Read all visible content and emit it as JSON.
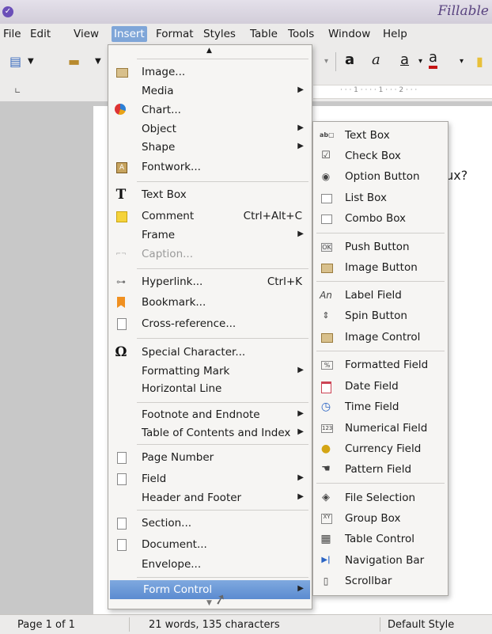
{
  "window": {
    "title": "Fillable"
  },
  "menubar": {
    "items": [
      "File",
      "Edit",
      "View",
      "Insert",
      "Format",
      "Styles",
      "Table",
      "Tools",
      "Window",
      "Help"
    ]
  },
  "document": {
    "visible_text": "nux?"
  },
  "insert_menu": {
    "items": [
      {
        "label": "Image...",
        "icon": "image-icon"
      },
      {
        "label": "Media",
        "submenu": true
      },
      {
        "label": "Chart...",
        "icon": "chart-icon"
      },
      {
        "label": "Object",
        "submenu": true
      },
      {
        "label": "Shape",
        "submenu": true
      },
      {
        "label": "Fontwork...",
        "icon": "fontwork-icon"
      },
      {
        "label": "Text Box",
        "icon": "text-box-icon"
      },
      {
        "label": "Comment",
        "shortcut": "Ctrl+Alt+C",
        "icon": "comment-icon"
      },
      {
        "label": "Frame",
        "submenu": true
      },
      {
        "label": "Caption...",
        "disabled": true,
        "icon": "caption-icon"
      },
      {
        "label": "Hyperlink...",
        "shortcut": "Ctrl+K",
        "icon": "hyperlink-icon"
      },
      {
        "label": "Bookmark...",
        "icon": "bookmark-icon"
      },
      {
        "label": "Cross-reference...",
        "icon": "cross-reference-icon"
      },
      {
        "label": "Special Character...",
        "icon": "omega-icon"
      },
      {
        "label": "Formatting Mark",
        "submenu": true
      },
      {
        "label": "Horizontal Line"
      },
      {
        "label": "Footnote and Endnote",
        "submenu": true
      },
      {
        "label": "Table of Contents and Index",
        "submenu": true
      },
      {
        "label": "Page Number",
        "icon": "page-number-icon"
      },
      {
        "label": "Field",
        "submenu": true,
        "icon": "field-icon"
      },
      {
        "label": "Header and Footer",
        "submenu": true
      },
      {
        "label": "Section...",
        "icon": "section-icon"
      },
      {
        "label": "Document...",
        "icon": "document-icon"
      },
      {
        "label": "Envelope..."
      },
      {
        "label": "Form Control",
        "submenu": true,
        "selected": true
      }
    ]
  },
  "form_control_menu": {
    "items": [
      {
        "label": "Text Box",
        "icon": "text-box-control-icon"
      },
      {
        "label": "Check Box",
        "icon": "check-box-icon"
      },
      {
        "label": "Option Button",
        "icon": "option-button-icon"
      },
      {
        "label": "List Box",
        "icon": "list-box-icon"
      },
      {
        "label": "Combo Box",
        "icon": "combo-box-icon"
      },
      {
        "label": "Push Button",
        "icon": "push-button-icon"
      },
      {
        "label": "Image Button",
        "icon": "image-button-icon"
      },
      {
        "label": "Label Field",
        "icon": "label-field-icon"
      },
      {
        "label": "Spin Button",
        "icon": "spin-button-icon"
      },
      {
        "label": "Image Control",
        "icon": "image-control-icon"
      },
      {
        "label": "Formatted Field",
        "icon": "formatted-field-icon"
      },
      {
        "label": "Date Field",
        "icon": "date-field-icon"
      },
      {
        "label": "Time Field",
        "icon": "time-field-icon"
      },
      {
        "label": "Numerical Field",
        "icon": "numerical-field-icon"
      },
      {
        "label": "Currency Field",
        "icon": "currency-field-icon"
      },
      {
        "label": "Pattern Field",
        "icon": "pattern-field-icon"
      },
      {
        "label": "File Selection",
        "icon": "file-selection-icon"
      },
      {
        "label": "Group Box",
        "icon": "group-box-icon"
      },
      {
        "label": "Table Control",
        "icon": "table-control-icon"
      },
      {
        "label": "Navigation Bar",
        "icon": "navigation-bar-icon"
      },
      {
        "label": "Scrollbar",
        "icon": "scrollbar-icon"
      }
    ]
  },
  "statusbar": {
    "page": "Page 1 of 1",
    "words": "21 words, 135 characters",
    "style": "Default Style"
  }
}
